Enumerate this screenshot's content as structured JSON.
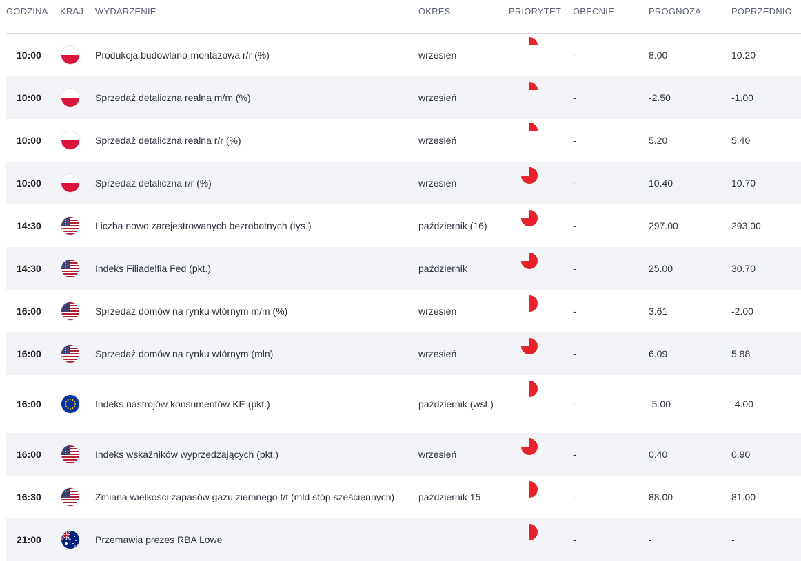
{
  "colors": {
    "accent": "#e8222d",
    "row_alt": "#f3f4f7",
    "divider": "#d9dce3"
  },
  "headers": {
    "time": "GODZINA",
    "country": "KRAJ",
    "event": "WYDARZENIE",
    "period": "OKRES",
    "priority": "PRIORYTET",
    "actual": "OBECNIE",
    "forecast": "PROGNOZA",
    "previous": "POPRZEDNIO"
  },
  "rows": [
    {
      "time": "10:00",
      "flag": "pl-flag-icon",
      "event": "Produkcja budowlano-montażowa r/r (%)",
      "period": "wrzesień",
      "priority": "low",
      "actual": "-",
      "forecast": "8.00",
      "previous": "10.20"
    },
    {
      "time": "10:00",
      "flag": "pl-flag-icon",
      "event": "Sprzedaż detaliczna realna m/m (%)",
      "period": "wrzesień",
      "priority": "low",
      "actual": "-",
      "forecast": "-2.50",
      "previous": "-1.00"
    },
    {
      "time": "10:00",
      "flag": "pl-flag-icon",
      "event": "Sprzedaż detaliczna realna r/r (%)",
      "period": "wrzesień",
      "priority": "low",
      "actual": "-",
      "forecast": "5.20",
      "previous": "5.40"
    },
    {
      "time": "10:00",
      "flag": "pl-flag-icon",
      "event": "Sprzedaż detaliczna r/r (%)",
      "period": "wrzesień",
      "priority": "high",
      "actual": "-",
      "forecast": "10.40",
      "previous": "10.70"
    },
    {
      "time": "14:30",
      "flag": "us-flag-icon",
      "event": "Liczba nowo zarejestrowanych bezrobotnych (tys.)",
      "period": "październik (16)",
      "priority": "high",
      "actual": "-",
      "forecast": "297.00",
      "previous": "293.00"
    },
    {
      "time": "14:30",
      "flag": "us-flag-icon",
      "event": "Indeks Filiadelfia Fed (pkt.)",
      "period": "październik",
      "priority": "high",
      "actual": "-",
      "forecast": "25.00",
      "previous": "30.70"
    },
    {
      "time": "16:00",
      "flag": "us-flag-icon",
      "event": "Sprzedaż domów na rynku wtórnym m/m (%)",
      "period": "wrzesień",
      "priority": "medium",
      "actual": "-",
      "forecast": "3.61",
      "previous": "-2.00"
    },
    {
      "time": "16:00",
      "flag": "us-flag-icon",
      "event": "Sprzedaż domów na rynku wtórnym (mln)",
      "period": "wrzesień",
      "priority": "high",
      "actual": "-",
      "forecast": "6.09",
      "previous": "5.88"
    },
    {
      "time": "16:00",
      "flag": "eu-flag-icon",
      "event": "Indeks nastrojów konsumentów KE (pkt.)",
      "period": "październik (wst.)",
      "priority": "medium",
      "actual": "-",
      "forecast": "-5.00",
      "previous": "-4.00"
    },
    {
      "time": "16:00",
      "flag": "us-flag-icon",
      "event": "Indeks wskaźników wyprzedzających (pkt.)",
      "period": "wrzesień",
      "priority": "high",
      "actual": "-",
      "forecast": "0.40",
      "previous": "0.90"
    },
    {
      "time": "16:30",
      "flag": "us-flag-icon",
      "event": "Zmiana wielkości zapasów gazu ziemnego t/t (mld stóp sześciennych)",
      "period": "październik 15",
      "priority": "medium",
      "actual": "-",
      "forecast": "88.00",
      "previous": "81.00"
    },
    {
      "time": "21:00",
      "flag": "au-flag-icon",
      "event": "Przemawia prezes RBA Lowe",
      "period": "",
      "priority": "medium",
      "actual": "-",
      "forecast": "-",
      "previous": "-"
    }
  ]
}
